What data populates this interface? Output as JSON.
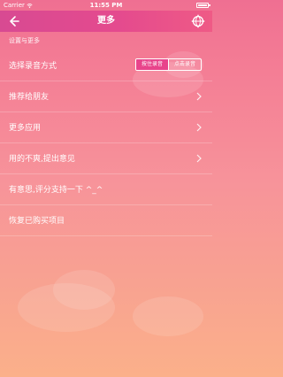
{
  "status_bar": {
    "carrier": "Carrier",
    "time": "11:55 PM"
  },
  "nav": {
    "title": "更多"
  },
  "section": {
    "header": "设置与更多"
  },
  "items": [
    {
      "label": "选择录音方式"
    },
    {
      "label": "推荐给朋友"
    },
    {
      "label": "更多应用"
    },
    {
      "label": "用的不爽,提出意见"
    },
    {
      "label": "有意思,评分支持一下 ^_^"
    },
    {
      "label": "恢复已购买项目"
    }
  ],
  "record_mode": {
    "options": [
      "按住录音",
      "点击录音"
    ],
    "selected": "按住录音"
  },
  "icons": {
    "back": "back-arrow-icon",
    "settings": "globe-gear-icon",
    "chevron": "chevron-right-icon",
    "wifi": "wifi-icon",
    "battery": "battery-icon"
  },
  "colors": {
    "nav_start": "#d84a92",
    "nav_end": "#ef5a86",
    "accent_selected": "#e8448b",
    "background_top": "#ef6f92",
    "background_bottom": "#fbb08a"
  }
}
